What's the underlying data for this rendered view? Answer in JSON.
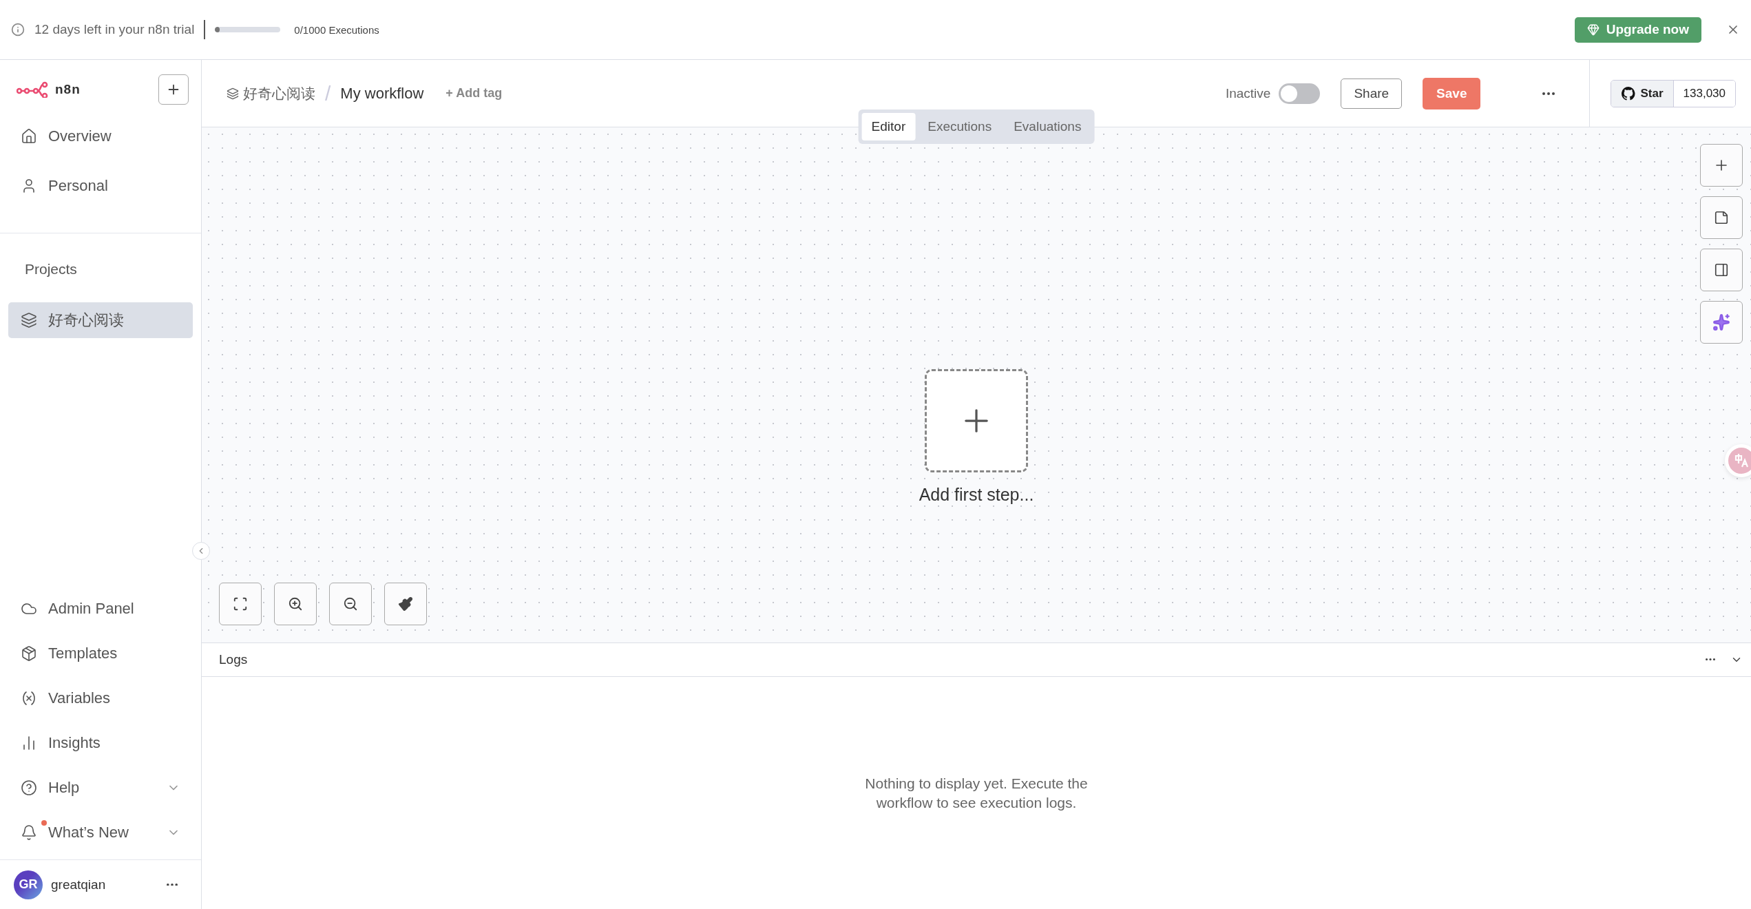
{
  "banner": {
    "trial_text": "12 days left in your n8n trial",
    "usage": {
      "level": 0.03,
      "reading": "0/1000 Executions"
    },
    "upgrade_label": "Upgrade now"
  },
  "sidebar": {
    "brand": "n8n",
    "top_items": [
      {
        "label": "Overview",
        "selected": false
      },
      {
        "label": "Personal",
        "selected": false
      }
    ],
    "projects_heading": "Projects",
    "projects": [
      {
        "label": "好奇心阅读",
        "selected": true
      }
    ],
    "bottom_items": [
      {
        "label": "Admin Panel",
        "selected": false
      },
      {
        "label": "Templates",
        "selected": false
      },
      {
        "label": "Variables",
        "selected": false
      },
      {
        "label": "Insights",
        "selected": false
      },
      {
        "label": "Help",
        "selected": false,
        "expanded": false
      },
      {
        "label": "What’s New",
        "selected": false,
        "expanded": false,
        "unread": true
      }
    ],
    "user": {
      "initials": "GR",
      "name": "greatqian"
    }
  },
  "header": {
    "project": "好奇心阅读",
    "separator": "/",
    "workflow": "My workflow",
    "add_tag": "+ Add tag",
    "status_label": "Inactive",
    "active": false,
    "share_label": "Share",
    "save_label": "Save",
    "star_label": "Star",
    "star_count": "133,030"
  },
  "tabs": [
    {
      "label": "Editor",
      "selected": true
    },
    {
      "label": "Executions",
      "selected": false
    },
    {
      "label": "Evaluations",
      "selected": false
    }
  ],
  "canvas": {
    "add_first_step": "Add first step..."
  },
  "logs": {
    "title": "Logs",
    "empty_message": "Nothing to display yet. Execute the workflow to see execution logs."
  }
}
